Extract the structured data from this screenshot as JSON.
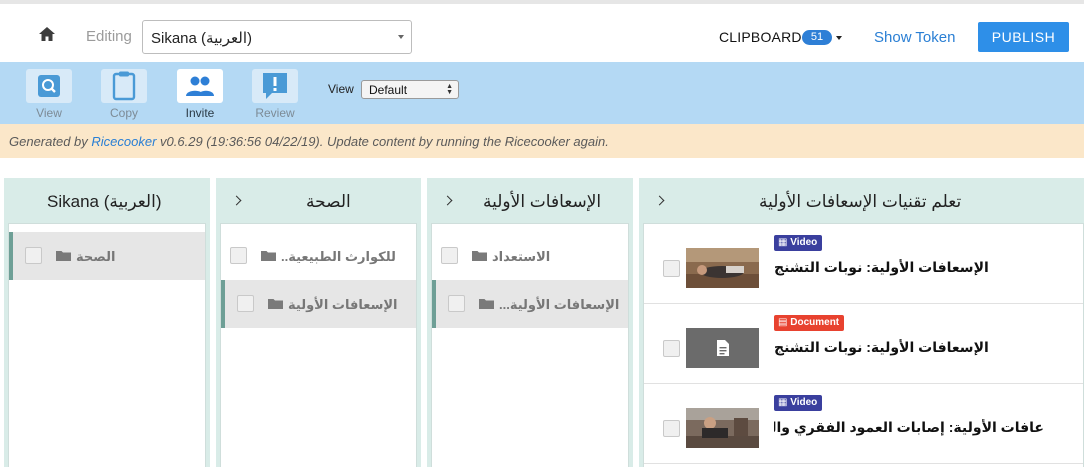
{
  "header": {
    "editing_label": "Editing",
    "channel_select_value": "Sikana (العربية)",
    "clipboard_label": "CLIPBOARD",
    "clipboard_count": "51",
    "show_token_label": "Show Token",
    "publish_label": "PUBLISH"
  },
  "toolbar": {
    "tools": [
      {
        "label": "View",
        "icon": "search-icon",
        "active": false
      },
      {
        "label": "Copy",
        "icon": "clipboard-icon",
        "active": false
      },
      {
        "label": "Invite",
        "icon": "people-icon",
        "active": true
      },
      {
        "label": "Review",
        "icon": "exclamation-icon",
        "active": false
      }
    ],
    "view_label": "View",
    "view_select_value": "Default"
  },
  "notice": {
    "prefix": "Generated by ",
    "link": "Ricecooker",
    "suffix": " v0.6.29 (19:36:56 04/22/19). Update content by running the Ricecooker again."
  },
  "columns": [
    {
      "title": "Sikana (العربية)",
      "items": [
        {
          "label": "الصحة",
          "selected": true
        }
      ]
    },
    {
      "title": "الصحة",
      "items": [
        {
          "label": "للكوارث الطبيعية..",
          "selected": false
        },
        {
          "label": "الإسعافات الأولية",
          "selected": true
        }
      ]
    },
    {
      "title": "الإسعافات الأولية",
      "items": [
        {
          "label": "الاستعداد",
          "selected": false
        },
        {
          "label": "الإسعافات الأولية...",
          "selected": true
        }
      ]
    },
    {
      "title": "تعلم تقنيات الإسعافات الأولية",
      "items": [
        {
          "kind": "Video",
          "title": "الإسعافات الأولية: نوبات التشنج"
        },
        {
          "kind": "Document",
          "title": "الإسعافات الأولية: نوبات التشنج"
        },
        {
          "kind": "Video",
          "title": "عافات الأولية: إصابات العمود الفقري والرأس"
        }
      ]
    }
  ],
  "colors": {
    "toolbar_bg": "#b4d9f4",
    "notice_bg": "#fbe7c9",
    "column_bg": "#d9ece8",
    "publish_bg": "#2e8fe8",
    "link": "#2a7fd4",
    "video_badge": "#3a3f9e",
    "document_badge": "#e8422f"
  }
}
